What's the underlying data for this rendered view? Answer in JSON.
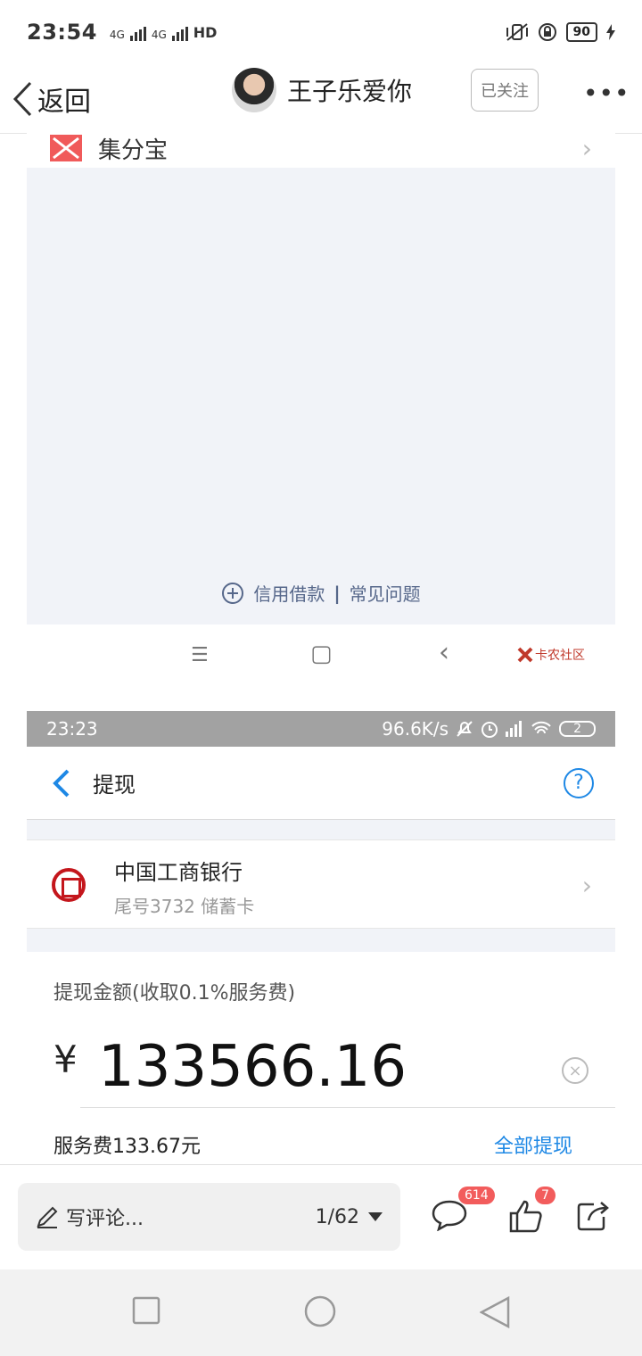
{
  "status_bar": {
    "time": "23:54",
    "network_1": "4G",
    "network_2": "4G",
    "hd": "HD",
    "battery": "90"
  },
  "header": {
    "back_label": "返回",
    "username": "王子乐爱你",
    "follow_label": "已关注",
    "more_label": "•••"
  },
  "shot1": {
    "row_label": "集分宝",
    "link_credit": "信用借款",
    "link_separator": "|",
    "link_faq": "常见问题",
    "nav_menu": "☰",
    "nav_home": "▢",
    "nav_back": "‹",
    "watermark": "卡农社区"
  },
  "shot2": {
    "status_time": "23:23",
    "status_speed": "96.6K/s",
    "status_battery": "2",
    "title": "提现",
    "help": "?",
    "bank_name": "中国工商银行",
    "bank_card": "尾号3732 储蓄卡",
    "amount_label": "提现金额(收取0.1%服务费)",
    "currency": "¥",
    "amount": "133566.16",
    "clear": "×",
    "fee": "服务费133.67元",
    "withdraw_all": "全部提现"
  },
  "bottom_bar": {
    "comment_placeholder": "写评论...",
    "page": "1/62",
    "comment_count": "614",
    "like_count": "7"
  },
  "colors": {
    "accent_blue": "#1e88e5",
    "badge_red": "#f25c5c",
    "bank_red": "#c4161c",
    "panel_bg": "#f1f3f8"
  }
}
